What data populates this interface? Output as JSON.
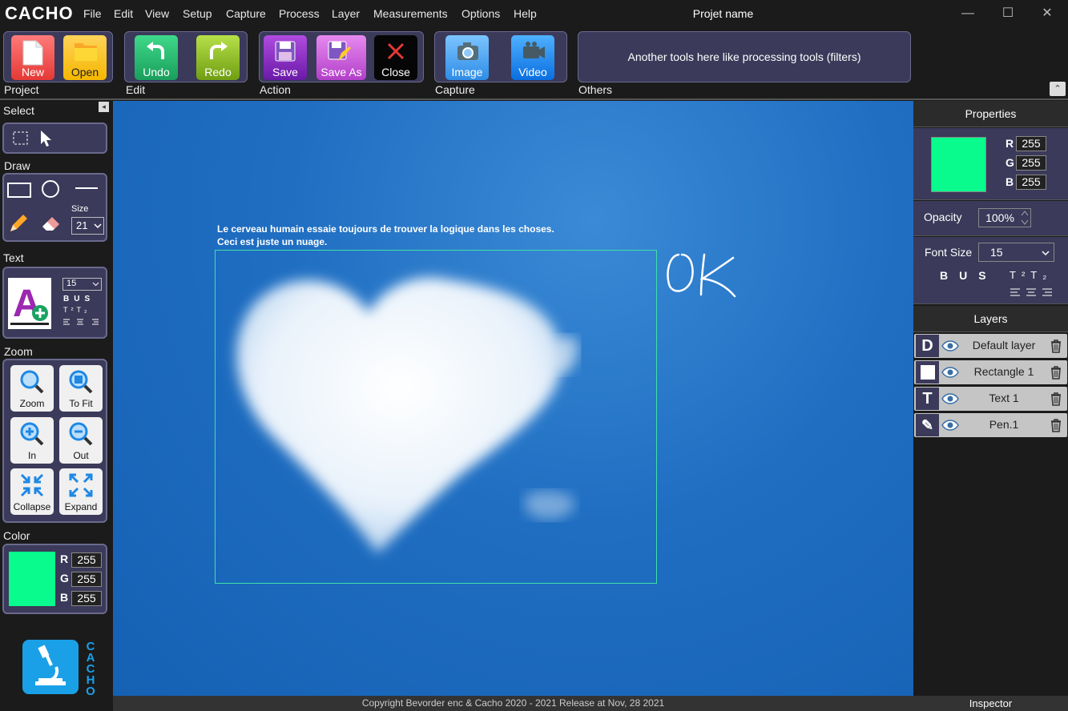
{
  "app": {
    "brand": "CACHO",
    "project_name": "Projet name"
  },
  "menu": [
    "File",
    "Edit",
    "View",
    "Setup",
    "Capture",
    "Process",
    "Layer",
    "Measurements",
    "Options",
    "Help"
  ],
  "window_controls": {
    "minimize": "—",
    "maximize": "☐",
    "close": "✕"
  },
  "ribbon": {
    "groups": {
      "project": "Project",
      "edit": "Edit",
      "action": "Action",
      "capture": "Capture",
      "others": "Others"
    },
    "buttons": {
      "new": "New",
      "open": "Open",
      "undo": "Undo",
      "redo": "Redo",
      "save": "Save",
      "save_as": "Save As",
      "close": "Close",
      "image": "Image",
      "video": "Video"
    },
    "others_text": "Another tools here like processing tools (filters)",
    "collapse_glyph": "⌃"
  },
  "left": {
    "select_title": "Select",
    "draw_title": "Draw",
    "size_label": "Size",
    "size_value": "21",
    "text_title": "Text",
    "text_font_size": "15",
    "zoom_title": "Zoom",
    "zoom_buttons": {
      "zoom": "Zoom",
      "to_fit": "To Fit",
      "in": "In",
      "out": "Out",
      "collapse": "Collapse",
      "expand": "Expand"
    },
    "color_title": "Color",
    "color": {
      "r_label": "R",
      "g_label": "G",
      "b_label": "B",
      "r": "255",
      "g": "255",
      "b": "255",
      "swatch": "#08fb8c"
    },
    "logo_text": "CACHO",
    "collapse_glyph": "◂"
  },
  "canvas": {
    "caption_line1": "Le cerveau humain essaie toujours de trouver la logique dans les choses.",
    "caption_line2": "Ceci est juste un nuage.",
    "handwriting": "Ok",
    "selection_color": "#3fe0a8"
  },
  "statusbar": "Copyright  Bevorder enc & Cacho   2020 - 2021    Release at  Nov, 28 2021",
  "right": {
    "expand_glyph": "▸",
    "properties_title": "Properties",
    "color": {
      "r_label": "R",
      "g_label": "G",
      "b_label": "B",
      "r": "255",
      "g": "255",
      "b": "255",
      "swatch": "#08fb8c"
    },
    "opacity_label": "Opacity",
    "opacity_value": "100%",
    "font_size_label": "Font Size",
    "font_size_value": "15",
    "layers_title": "Layers",
    "layers": [
      {
        "icon": "D",
        "name": "Default layer"
      },
      {
        "icon": "■",
        "name": "Rectangle 1"
      },
      {
        "icon": "T",
        "name": "Text 1"
      },
      {
        "icon": "✎",
        "name": "Pen.1"
      }
    ],
    "inspector_tab": "Inspector"
  }
}
